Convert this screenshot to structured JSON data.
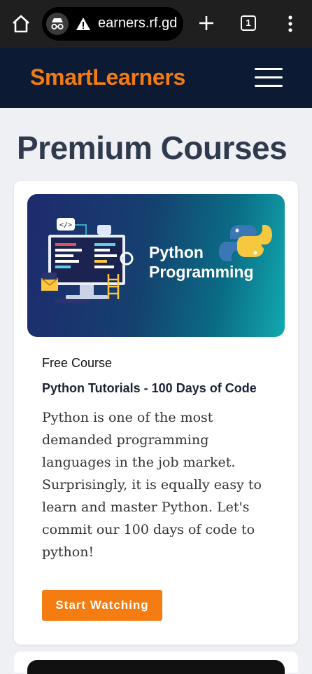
{
  "browser": {
    "url": "earners.rf.gd",
    "tab_count": "1",
    "icons": [
      "home-icon",
      "incognito-icon",
      "warning-icon",
      "plus-icon",
      "tabs-icon",
      "more-vert-icon"
    ]
  },
  "site": {
    "logo": "SmartLearners",
    "menu_icon": "hamburger-icon",
    "colors": {
      "header_bg": "#0c1b33",
      "accent": "#f47b12"
    }
  },
  "page": {
    "title": "Premium Courses"
  },
  "course": {
    "thumbnail": {
      "line1": "Python",
      "line2": "Programming"
    },
    "type": "Free Course",
    "title": "Python Tutorials - 100 Days of Code",
    "description": "Python is one of the most demanded programming languages in the job market. Surprisingly, it is equally easy to learn and master Python. Let's commit our 100 days of code to python!",
    "button_label": "Start Watching"
  }
}
